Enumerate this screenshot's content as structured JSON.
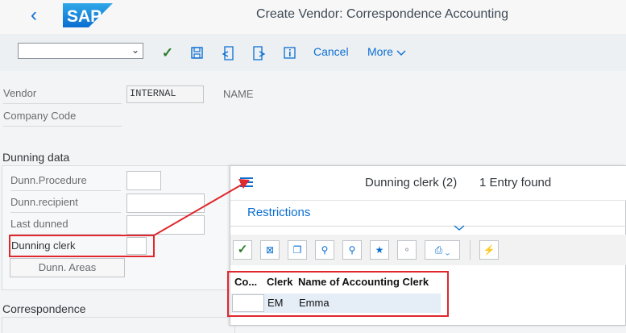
{
  "header": {
    "title": "Create Vendor: Correspondence Accounting",
    "back_label": "‹",
    "logo_text": "SAP"
  },
  "toolbar": {
    "command_value": "",
    "cancel_label": "Cancel",
    "more_label": "More"
  },
  "vendor": {
    "label": "Vendor",
    "value": "INTERNAL",
    "name": "NAME"
  },
  "company_code": {
    "label": "Company Code"
  },
  "dunning": {
    "section_title": "Dunning data",
    "procedure_label": "Dunn.Procedure",
    "recipient_label": "Dunn.recipient",
    "last_dunned_label": "Last dunned",
    "clerk_label": "Dunning clerk",
    "areas_button": "Dunn. Areas"
  },
  "correspondence": {
    "section_title": "Correspondence"
  },
  "popup": {
    "title": "Dunning clerk (2)",
    "entries": "1 Entry found",
    "restrictions_label": "Restrictions",
    "columns": [
      "Co...",
      "Clerk",
      "Name of Accounting Clerk"
    ],
    "rows": [
      {
        "co": "",
        "clerk": "EM",
        "name": "Emma"
      }
    ]
  },
  "colors": {
    "accent": "#0a6ed1",
    "annotation": "#e0282e",
    "ok_green": "#2b7c2b"
  }
}
